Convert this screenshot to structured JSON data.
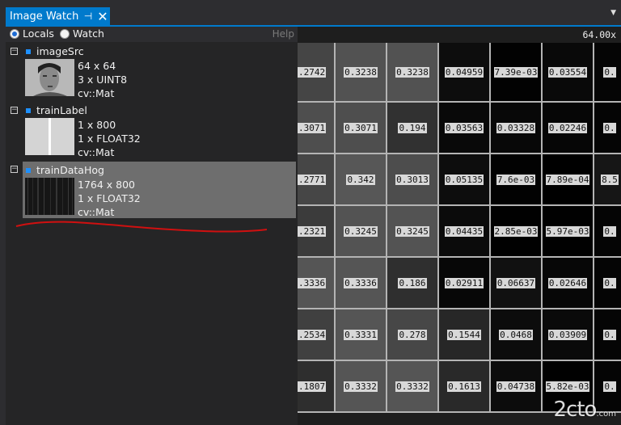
{
  "tab": {
    "title": "Image Watch",
    "pin_glyph": "⊣",
    "close_glyph": "✕"
  },
  "toolbar": {
    "locals_label": "Locals",
    "watch_label": "Watch",
    "help_label": "Help",
    "selected": "Locals"
  },
  "variables": [
    {
      "name": "imageSrc",
      "dims": "64 x 64",
      "channels": "3 x UINT8",
      "type": "cv::Mat",
      "selected": false
    },
    {
      "name": "trainLabel",
      "dims": "1 x 800",
      "channels": "1 x FLOAT32",
      "type": "cv::Mat",
      "selected": false
    },
    {
      "name": "trainDataHog",
      "dims": "1764 x 800",
      "channels": "1 x FLOAT32",
      "type": "cv::Mat",
      "selected": true
    }
  ],
  "viewer": {
    "zoom": "64.00x",
    "cells": [
      [
        ".2742",
        "0.3238",
        "0.3238",
        "0.04959",
        "7.39e-03",
        "0.03554",
        "0."
      ],
      [
        ".3071",
        "0.3071",
        "0.194",
        "0.03563",
        "0.03328",
        "0.02246",
        "0."
      ],
      [
        ".2771",
        "0.342",
        "0.3013",
        "0.05135",
        "7.6e-03",
        "7.89e-04",
        "8.5"
      ],
      [
        ".2321",
        "0.3245",
        "0.3245",
        "0.04435",
        "2.85e-03",
        "5.97e-03",
        "0."
      ],
      [
        ".3336",
        "0.3336",
        "0.186",
        "0.02911",
        "0.06637",
        "0.02646",
        "0."
      ],
      [
        ".2534",
        "0.3331",
        "0.278",
        "0.1544",
        "0.0468",
        "0.03909",
        "0."
      ],
      [
        ".1807",
        "0.3332",
        "0.3332",
        "0.1613",
        "0.04738",
        "5.82e-03",
        "0."
      ]
    ],
    "shades": [
      [
        "#454545",
        "#525252",
        "#525252",
        "#0d0d0d",
        "#020202",
        "#090909",
        "#050505"
      ],
      [
        "#4e4e4e",
        "#4e4e4e",
        "#313131",
        "#090909",
        "#080808",
        "#060606",
        "#050505"
      ],
      [
        "#464646",
        "#575757",
        "#4d4d4d",
        "#0d0d0d",
        "#020202",
        "#000000",
        "#161616"
      ],
      [
        "#3b3b3b",
        "#535353",
        "#535353",
        "#0b0b0b",
        "#010101",
        "#010101",
        "#050505"
      ],
      [
        "#555555",
        "#555555",
        "#2f2f2f",
        "#070707",
        "#111111",
        "#070707",
        "#050505"
      ],
      [
        "#404040",
        "#555555",
        "#474747",
        "#272727",
        "#0c0c0c",
        "#0a0a0a",
        "#050505"
      ],
      [
        "#2e2e2e",
        "#555555",
        "#555555",
        "#292929",
        "#0c0c0c",
        "#010101",
        "#050505"
      ]
    ]
  },
  "watermark": {
    "text": "2cto",
    "suffix": ".com"
  },
  "colors": {
    "accent": "#007acc",
    "panel": "#252526",
    "selected_row": "#6e6e6e",
    "annotation": "#d01010"
  }
}
